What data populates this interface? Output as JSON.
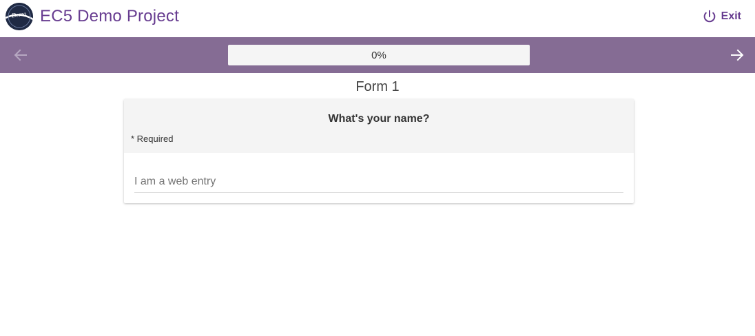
{
  "header": {
    "logo_text": "Demo",
    "title": "EC5 Demo Project",
    "exit_label": "Exit",
    "exit_icon": "power-icon"
  },
  "toolbar": {
    "prev_icon": "arrow-left-icon",
    "next_icon": "arrow-right-icon",
    "progress_label": "0%",
    "progress_value": 0
  },
  "form": {
    "title": "Form 1",
    "question": "What's your name?",
    "required_label": "* Required",
    "answer_placeholder": "I am a web entry",
    "answer_value": ""
  },
  "colors": {
    "brand": "#673c90",
    "toolbar": "#856c94",
    "card_header": "#f4f4f4"
  }
}
